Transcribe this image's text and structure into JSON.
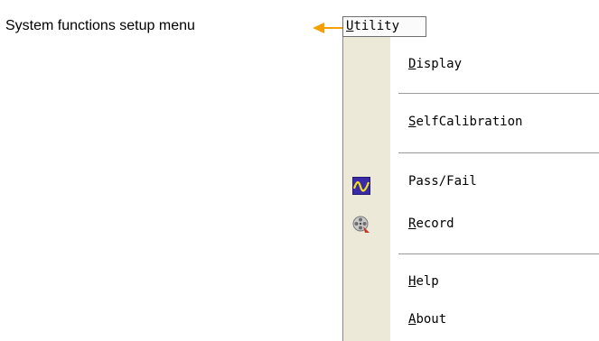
{
  "annotation": {
    "text": "System functions setup menu",
    "arrow_color": "#f5a000"
  },
  "menu": {
    "title_first": "U",
    "title_rest": "tility",
    "items": [
      {
        "first": "D",
        "rest": "isplay",
        "icon": null
      },
      {
        "first": "S",
        "rest": "elfCalibration",
        "icon": null
      },
      {
        "first": "",
        "rest": "Pass/Fail",
        "icon": "pass-fail-waveform-icon"
      },
      {
        "first": "R",
        "rest": "ecord",
        "icon": "film-reel-icon"
      },
      {
        "first": "H",
        "rest": "elp",
        "icon": null
      },
      {
        "first": "A",
        "rest": "bout",
        "icon": null
      }
    ]
  }
}
